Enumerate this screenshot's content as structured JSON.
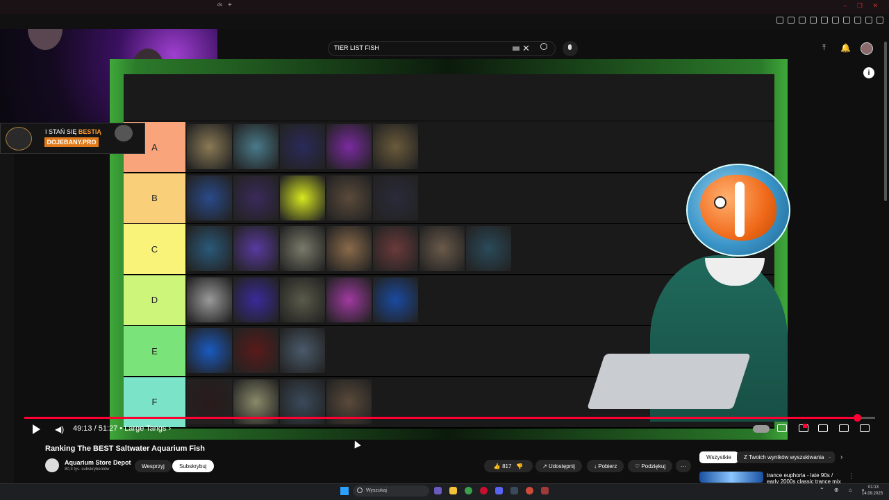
{
  "browser": {
    "tab_text": "ds",
    "new_tab": "+",
    "window_controls": "– ❐ ✕"
  },
  "header": {
    "search_query": "TIER LIST FISH",
    "clear_glyph": "✕",
    "upload_glyph": "⤒",
    "bell_glyph": "🔔"
  },
  "stream_overlay": {
    "banner_line1": "I STAŃ SIĘ",
    "banner_line1_accent": "BESTIĄ",
    "banner_line2": "DOJEBANY.PRO"
  },
  "tier_list": {
    "tiers": [
      {
        "label": "A",
        "color": "#f9a47a",
        "fish": [
          "#8a7a55",
          "#4a7a8a",
          "#2a2a5a",
          "#7a2aa0",
          "#6a5a3a"
        ]
      },
      {
        "label": "B",
        "color": "#f9cf7a",
        "fish": [
          "#2a4a8a",
          "#3a2a5a",
          "#d8e820",
          "#5a4a3a",
          "#2a2a3a"
        ]
      },
      {
        "label": "C",
        "color": "#f9f37a",
        "fish": [
          "#2a5a7a",
          "#5a3aa0",
          "#7a7a6a",
          "#8a6a4a",
          "#6a3a3a",
          "#6a5a4a",
          "#2a4a5a"
        ]
      },
      {
        "label": "D",
        "color": "#cdf57a",
        "fish": [
          "#9a9a9a",
          "#3a2a9a",
          "#5a5a4a",
          "#a03aa0",
          "#1a4aa0"
        ]
      },
      {
        "label": "E",
        "color": "#7ae37a",
        "fish": [
          "#1a5ac0",
          "#5a1a1a",
          "#4a5a6a"
        ]
      },
      {
        "label": "F",
        "color": "#7ae3c8",
        "fish": [
          "#2a1a1a",
          "#8a8a6a",
          "#3a4a5a",
          "#5a4a3a"
        ]
      }
    ]
  },
  "player": {
    "progress": 0.9788,
    "time_text": "49:13 / 51:27 • Large Tangs ›",
    "info_glyph": "i"
  },
  "video": {
    "title": "Ranking The BEST Saltwater Aquarium Fish",
    "channel_name": "Aquarium Store Depot",
    "channel_subs": "80,3 tys. subskrybentów",
    "support_label": "Wesprzyj",
    "subscribe_label": "Subskrybuj",
    "like_count": "817",
    "share_label": "Udostępnij",
    "download_label": "Pobierz",
    "thanks_label": "Podziękuj",
    "more_label": "···"
  },
  "sidebar": {
    "chips": [
      "Wszystkie",
      "Z Twoich wyników wyszukiwania",
      "·"
    ],
    "chip_next": "›",
    "rec_title": "trance euphoria - late 90s / early 2000s classic trance mix",
    "rec_more": "⋮"
  },
  "taskbar": {
    "search_placeholder": "Wyszukaj",
    "tray": "⌃ ⊕ ⌂ ◐",
    "clock_time": "01:13",
    "clock_date": "14.09.2025"
  },
  "colors": {
    "accent": "#ff0033",
    "background": "#0f0f0f"
  }
}
